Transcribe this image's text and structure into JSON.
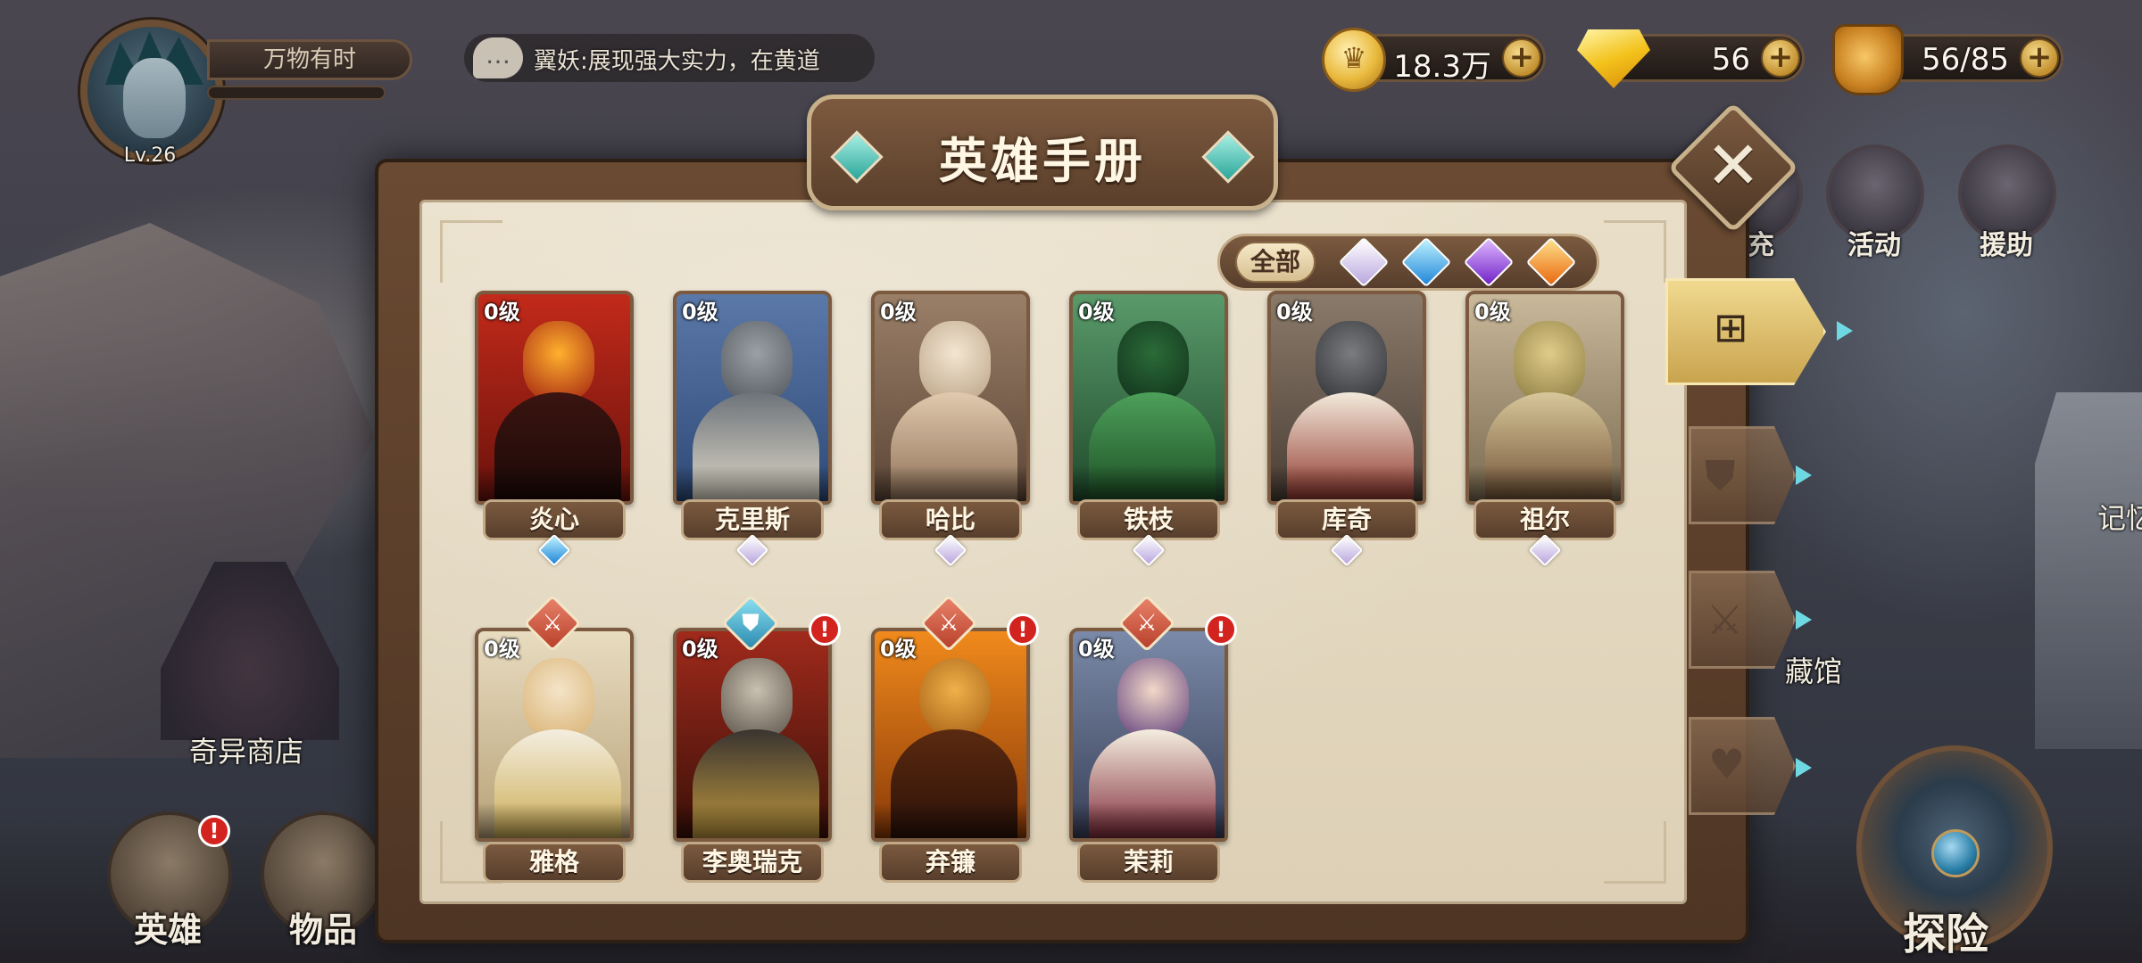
{
  "player": {
    "name": "万物有时",
    "level": "Lv.26"
  },
  "chat": {
    "message": "翼妖:展现强大实力，在黄道"
  },
  "currencies": {
    "gold": "18.3万",
    "diamonds": "56",
    "stamina": "56/85",
    "plus": "+"
  },
  "side_menu": {
    "recharge_partial": "充",
    "activity": "活动",
    "assist": "援助",
    "museum_partial": "藏馆",
    "memory_partial": "记忆"
  },
  "bottom_nav": {
    "shop": "奇异商店",
    "heroes": "英雄",
    "items": "物品",
    "explore": "探险",
    "badge": "!"
  },
  "modal": {
    "title": "英雄手册",
    "close": "✕",
    "filter_all": "全部"
  },
  "filter_colors": {
    "white": "#d9c8f2",
    "blue": "#3aa8e8",
    "purple": "#8a3fd8",
    "orange": "#f08a1c"
  },
  "heroes": [
    {
      "name": "炎心",
      "level": "0级",
      "rarity": "blue"
    },
    {
      "name": "克里斯",
      "level": "0级",
      "rarity": "white"
    },
    {
      "name": "哈比",
      "level": "0级",
      "rarity": "white"
    },
    {
      "name": "铁枝",
      "level": "0级",
      "rarity": "white"
    },
    {
      "name": "库奇",
      "level": "0级",
      "rarity": "white"
    },
    {
      "name": "祖尔",
      "level": "0级",
      "rarity": "white"
    },
    {
      "name": "雅格",
      "level": "0级",
      "rarity": "white"
    },
    {
      "name": "李奥瑞克",
      "level": "0级",
      "rarity": "white"
    },
    {
      "name": "弃镰",
      "level": "0级",
      "rarity": "white"
    },
    {
      "name": "茉莉",
      "level": "0级",
      "rarity": "white"
    }
  ],
  "icons": {
    "chat": "speech-bubble-icon",
    "coin": "gold-coin-icon",
    "diamond": "diamond-icon",
    "stamina": "stamina-icon",
    "grid_tab": "grid-icon",
    "shield_tab": "shield-icon",
    "sword_tab": "sword-icon",
    "heart_tab": "heart-icon"
  }
}
